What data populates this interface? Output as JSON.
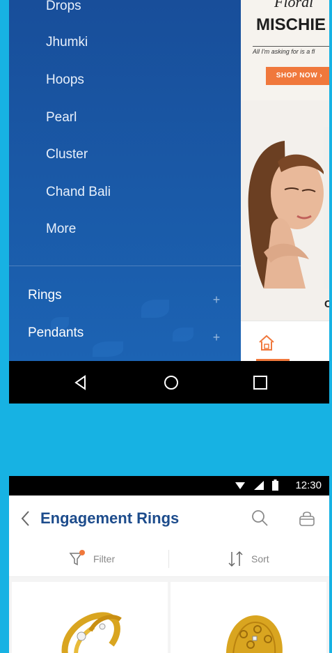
{
  "drawer": {
    "sub_items": [
      "Drops",
      "Jhumki",
      "Hoops",
      "Pearl",
      "Cluster",
      "Chand Bali",
      "More"
    ],
    "categories": [
      {
        "label": "Rings",
        "expand_icon": "plus-icon"
      },
      {
        "label": "Pendants",
        "expand_icon": "plus-icon"
      }
    ],
    "plus_symbol": "+"
  },
  "banner": {
    "script_text": "Floral",
    "title": "MISCHIE",
    "tagline": "All I'm asking for is a fl",
    "button_label": "SHOP NOW ›"
  },
  "content": {
    "partial_letter": "C",
    "tab_icon": "home-icon"
  },
  "system_nav": {
    "back_icon": "back-triangle-icon",
    "home_icon": "home-circle-icon",
    "recents_icon": "recents-square-icon"
  },
  "status_bar": {
    "time": "12:30",
    "icons": [
      "wifi-icon",
      "signal-icon",
      "battery-icon"
    ]
  },
  "listing": {
    "title": "Engagement Rings",
    "filter_label": "Filter",
    "sort_label": "Sort"
  },
  "colors": {
    "page_background": "#17b2e3",
    "drawer_blue": "#1a5aa8",
    "title_blue": "#1d4c8c",
    "accent_orange": "#f0783c",
    "gold": "#d9a520"
  }
}
